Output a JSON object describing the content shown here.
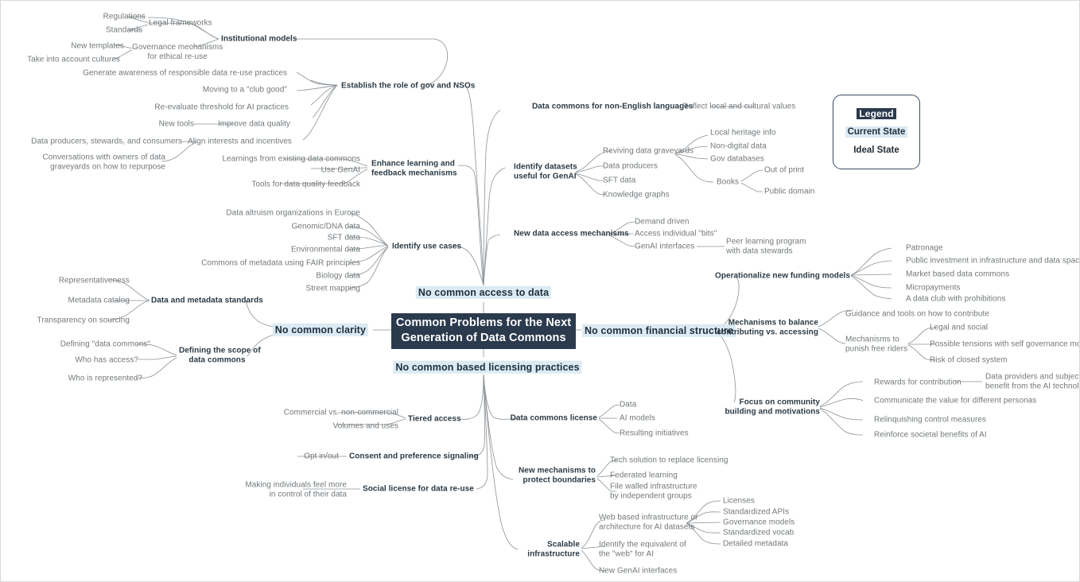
{
  "center": {
    "title_line1": "Common Problems for the Next",
    "title_line2": "Generation of Data Commons"
  },
  "legend": {
    "title": "Legend",
    "current_state": "Current State",
    "ideal_state": "Ideal State"
  },
  "problems": {
    "access": "No common access to data",
    "financial": "No common financial structure",
    "clarity": "No common clarity",
    "licensing": "No common based licensing practices"
  },
  "branches": {
    "establish_role": "Establish the role of gov and NSOs",
    "institutional_models": "Institutional models",
    "legal_frameworks": "Legal frameworks",
    "regulations": "Regulations",
    "standards": "Standards",
    "governance_mech_l1": "Governance mechanisms",
    "governance_mech_l2": "for ethical re-use",
    "new_templates": "New templates",
    "take_into_account_cultures": "Take into account cultures",
    "generate_awareness": "Generate awareness of responsible data re-use practices",
    "moving_club_good": "Moving to a \"club good\"",
    "reevaluate_threshold": "Re-evaluate threshold for AI practices",
    "improve_data_quality": "Improve data quality",
    "new_tools": "New tools",
    "align_interests": "Align interests and incentives",
    "data_producers_stewards": "Data producers, stewards, and consumers",
    "conversations_owners_l1": "Conversations with owners of data",
    "conversations_owners_l2": "graveyards on how to repurpose",
    "enhance_learning_l1": "Enhance learning and",
    "enhance_learning_l2": "feedback mechanisms",
    "learnings_existing": "Learnings from existing data commons",
    "use_genai": "Use GenAI",
    "tools_quality_feedback": "Tools for data quality feedback",
    "identify_use_cases": "Identify use cases",
    "data_altruism": "Data altruism organizations in Europe",
    "genomic_dna": "Genomic/DNA data",
    "sft_data_uc": "SFT data",
    "environmental_data": "Environmental data",
    "commons_metadata_fair": "Commons of metadata using FAIR principles",
    "biology_data": "Biology data",
    "street_mapping": "Street mapping",
    "data_metadata_standards": "Data and metadata standards",
    "representativeness": "Representativeness",
    "metadata_catalog": "Metadata catalog",
    "transparency_sourcing": "Transparency on sourcing",
    "defining_scope_l1": "Defining the scope of",
    "defining_scope_l2": "data commons",
    "defining_data_commons": "Defining \"data commons\"",
    "who_has_access": "Who has access?",
    "who_is_represented": "Who is represented?",
    "data_commons_nonenglish": "Data commons for non-English languages",
    "reflect_local_cultural": "Reflect local and cultural values",
    "identify_datasets_l1": "Identify datasets",
    "identify_datasets_l2": "useful for GenAI",
    "reviving_graveyards": "Reviving data graveyards",
    "data_producers": "Data producers",
    "sft_data": "SFT data",
    "knowledge_graphs": "Knowledge graphs",
    "local_heritage": "Local heritage info",
    "non_digital_data": "Non-digital data",
    "gov_databases": "Gov databases",
    "books": "Books",
    "out_of_print": "Out of print",
    "public_domain": "Public domain",
    "new_data_access": "New data access mechanisms",
    "demand_driven": "Demand driven",
    "access_individual_bits": "Access individual \"bits\"",
    "genai_interfaces": "GenAI interfaces",
    "peer_learning_l1": "Peer learning program",
    "peer_learning_l2": "with data stewards",
    "operationalize_funding": "Operationalize new funding models",
    "patronage": "Patronage",
    "public_investment": "Public investment in infrastructure and data spaces",
    "market_based": "Market based data commons",
    "micropayments": "Micropayments",
    "data_club_prohibitions": "A data club with prohibitions",
    "mechanisms_balance_l1": "Mechanisms to balance",
    "mechanisms_balance_l2": "contributing vs. accessing",
    "guidance_tools": "Guidance and tools on how to contribute",
    "mechanisms_punish_l1": "Mechanisms to",
    "mechanisms_punish_l2": "punish free riders",
    "legal_and_social": "Legal and social",
    "possible_tensions": "Possible tensions with self governance model",
    "risk_closed_system": "Risk of closed system",
    "focus_community_l1": "Focus on community",
    "focus_community_l2": "building and motivations",
    "rewards_contribution": "Rewards for contribution",
    "data_providers_benefit_l1": "Data providers and subjects",
    "data_providers_benefit_l2": "benefit from the AI technology",
    "communicate_value": "Communicate the value for different personas",
    "relinquishing_control": "Relinquishing control measures",
    "reinforce_societal": "Reinforce societal benefits of AI",
    "tiered_access": "Tiered access",
    "commercial_noncommercial": "Commercial vs. non-commercial",
    "volumes_uses": "Volumes and uses",
    "consent_preference": "Consent and preference signaling",
    "opt_in_out": "Opt in/out",
    "social_license": "Social license for data re-use",
    "making_individuals_l1": "Making individuals feel more",
    "making_individuals_l2": "in control of their data",
    "data_commons_license": "Data commons license",
    "data": "Data",
    "ai_models": "AI models",
    "resulting_initiatives": "Resulting initiatives",
    "new_mechanisms_l1": "New mechanisms to",
    "new_mechanisms_l2": "protect boundaries",
    "tech_solution": "Tech solution to replace licensing",
    "federated_learning": "Federated learning",
    "file_walled_l1": "File walled infrastructure",
    "file_walled_l2": "by independent groups",
    "scalable_infra_l1": "Scalable",
    "scalable_infra_l2": "infrastructure",
    "web_based_l1": "Web based infrastructure or",
    "web_based_l2": "architecture for AI datasets",
    "identify_equivalent_l1": "Identify the equivalent of",
    "identify_equivalent_l2": "the \"web\" for AI",
    "new_genai_interfaces": "New GenAI interfaces",
    "licenses": "Licenses",
    "standardized_apis": "Standardized APIs",
    "governance_models": "Governance models",
    "standardized_vocab": "Standardized vocab",
    "detailed_metadata": "Detailed metadata"
  },
  "colors": {
    "center_bg": "#2b3a4d",
    "current_state_bg": "#dbeaf3",
    "branch_text": "#2b3a45",
    "leaf_text": "#72787c",
    "wire": "#8b9196"
  }
}
